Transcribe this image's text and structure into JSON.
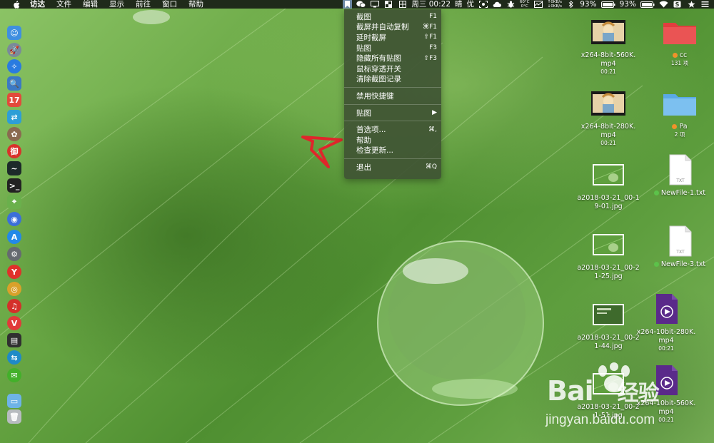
{
  "menubar": {
    "app_name": "访达",
    "items": [
      "文件",
      "编辑",
      "显示",
      "前往",
      "窗口",
      "帮助"
    ],
    "clock": "周三 00:22",
    "weather": "晴",
    "input_method": "优",
    "net_temp_top": "60°C",
    "net_temp_bottom": "0°C",
    "net_up": "↑0KB/s",
    "net_down": "↓0KB/s",
    "battery1": "93%",
    "battery2": "93%"
  },
  "dropdown": {
    "groups": [
      [
        {
          "label": "截图",
          "shortcut": "F1"
        },
        {
          "label": "截屏并自动复制",
          "shortcut": "⌘F1"
        },
        {
          "label": "延时截屏",
          "shortcut": "⇧F1"
        },
        {
          "label": "贴图",
          "shortcut": "F3"
        },
        {
          "label": "隐藏所有贴图",
          "shortcut": "⇧F3"
        },
        {
          "label": "鼠标穿透开关",
          "shortcut": ""
        },
        {
          "label": "清除截图记录",
          "shortcut": ""
        }
      ],
      [
        {
          "label": "禁用快捷键",
          "shortcut": ""
        }
      ],
      [
        {
          "label": "贴图",
          "shortcut": "▶"
        }
      ],
      [
        {
          "label": "首选项...",
          "shortcut": "⌘,"
        },
        {
          "label": "帮助",
          "shortcut": ""
        },
        {
          "label": "检查更新...",
          "shortcut": ""
        }
      ],
      [
        {
          "label": "退出",
          "shortcut": "⌘Q"
        }
      ]
    ]
  },
  "dock": {
    "icons": [
      {
        "name": "finder-icon",
        "color": "#3f8fe0",
        "glyph": "☺"
      },
      {
        "name": "launchpad-icon",
        "color": "#7a8a9a",
        "glyph": "🚀"
      },
      {
        "name": "safari-icon",
        "color": "#2a7be0",
        "glyph": "✧"
      },
      {
        "name": "preview-icon",
        "color": "#3b79c4",
        "glyph": "🔍"
      },
      {
        "name": "calendar-icon",
        "color": "#e24a3b",
        "glyph": "17"
      },
      {
        "name": "migration-icon",
        "color": "#2e9ed6",
        "glyph": "⇄"
      },
      {
        "name": "photos-icon",
        "color": "#8a6a50",
        "glyph": "✿"
      },
      {
        "name": "weibo-icon",
        "color": "#d9322b",
        "glyph": "御"
      },
      {
        "name": "activity-monitor-icon",
        "color": "#1d2a2a",
        "glyph": "~"
      },
      {
        "name": "terminal-icon",
        "color": "#222222",
        "glyph": ">_"
      },
      {
        "name": "maps-icon",
        "color": "#6ab04c",
        "glyph": "⌖"
      },
      {
        "name": "siri-icon",
        "color": "#3c6fd9",
        "glyph": "◉"
      },
      {
        "name": "app-store-icon",
        "color": "#2389e8",
        "glyph": "A"
      },
      {
        "name": "system-preferences-icon",
        "color": "#666a70",
        "glyph": "⚙"
      },
      {
        "name": "yandex-icon",
        "color": "#e0312b",
        "glyph": "Y"
      },
      {
        "name": "chrome-icon",
        "color": "#d9a12a",
        "glyph": "◎"
      },
      {
        "name": "netease-music-icon",
        "color": "#d4302a",
        "glyph": "♫"
      },
      {
        "name": "vivaldi-icon",
        "color": "#e13a3a",
        "glyph": "V"
      },
      {
        "name": "console-icon",
        "color": "#303030",
        "glyph": "▤"
      },
      {
        "name": "teamviewer-icon",
        "color": "#1f8ac7",
        "glyph": "⇆"
      },
      {
        "name": "wechat-icon",
        "color": "#43b02a",
        "glyph": "✉"
      },
      {
        "name": "downloads-folder-icon",
        "color": "#6eb3e8",
        "glyph": "▭"
      },
      {
        "name": "trash-icon",
        "color": "#b8bcc0",
        "glyph": "🗑"
      }
    ]
  },
  "desktop": {
    "items": [
      {
        "name": "video-file-item",
        "label1": "x264-8bit-560K.",
        "label2": "mp4",
        "sub": "00:21",
        "kind": "video-thumb"
      },
      {
        "name": "folder-item",
        "label1": "cc",
        "label2": "",
        "sub": "131 项",
        "kind": "folder-red",
        "dot": "#f0922a"
      },
      {
        "name": "video-file-item",
        "label1": "x264-8bit-280K.",
        "label2": "mp4",
        "sub": "00:21",
        "kind": "video-thumb"
      },
      {
        "name": "folder-item",
        "label1": "Pa",
        "label2": "",
        "sub": "2 项",
        "kind": "folder-blue",
        "dot": "#f0922a"
      },
      {
        "name": "image-file-item",
        "label1": "a2018-03-21_00-1",
        "label2": "9-01.jpg",
        "sub": "",
        "kind": "image-thumb"
      },
      {
        "name": "text-file-item",
        "label1": "NewFile-1.txt",
        "label2": "",
        "sub": "",
        "kind": "txt",
        "dot": "#5cc24a"
      },
      {
        "name": "image-file-item",
        "label1": "a2018-03-21_00-2",
        "label2": "1-25.jpg",
        "sub": "",
        "kind": "image-thumb"
      },
      {
        "name": "text-file-item",
        "label1": "NewFile-3.txt",
        "label2": "",
        "sub": "",
        "kind": "txt",
        "dot": "#5cc24a"
      },
      {
        "name": "image-file-item",
        "label1": "a2018-03-21_00-2",
        "label2": "1-44.jpg",
        "sub": "",
        "kind": "image-dark"
      },
      {
        "name": "video-file-item",
        "label1": "x264-10bit-280K.",
        "label2": "mp4",
        "sub": "00:21",
        "kind": "purple-video"
      },
      {
        "name": "image-file-item",
        "label1": "a2018-03-21_00-2",
        "label2": "1-51.jpg",
        "sub": "",
        "kind": "image-thumb"
      },
      {
        "name": "video-file-item",
        "label1": "x264-10bit-560K.",
        "label2": "mp4",
        "sub": "00:21",
        "kind": "purple-video"
      }
    ]
  },
  "watermark": {
    "logo": "Bai",
    "logo_cn": "经验",
    "url": "jingyan.baidu.com"
  }
}
